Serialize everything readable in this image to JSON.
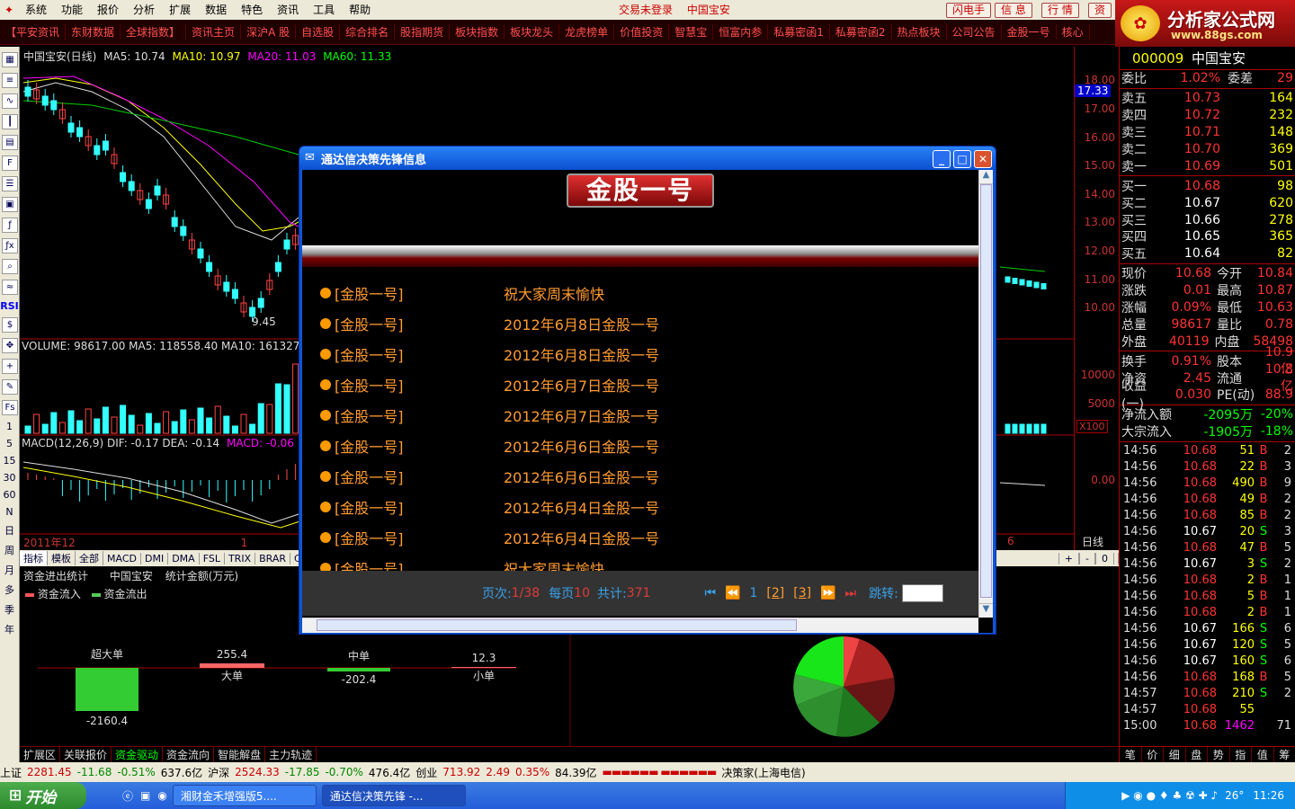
{
  "app": {
    "menu": [
      "系统",
      "功能",
      "报价",
      "分析",
      "扩展",
      "数据",
      "特色",
      "资讯",
      "工具",
      "帮助"
    ],
    "trade_status": "交易未登录",
    "current_stock": "中国宝安",
    "right_buttons": [
      "闪电手",
      "信 息",
      "行 情",
      "资"
    ]
  },
  "brand": {
    "title": "分析家公式网",
    "url": "www.88gs.com"
  },
  "quick_links": [
    "【平安资讯",
    "东财数据",
    "全球指数】",
    "资讯主页",
    "深沪A 股",
    "自选股",
    "综合排名",
    "股指期货",
    "板块指数",
    "板块龙头",
    "龙虎榜单",
    "价值投资",
    "智慧宝",
    "恒富内参",
    "私募密函1",
    "私募密函2",
    "热点板块",
    "公司公告",
    "金股一号",
    "核心"
  ],
  "left_tools": [
    "RSI",
    "1",
    "5",
    "15",
    "30",
    "60",
    "N",
    "日",
    "周",
    "月",
    "多",
    "季",
    "年"
  ],
  "chart": {
    "header_name": "中国宝安(日线)",
    "ma5": "MA5: 10.74",
    "ma10": "MA10: 10.97",
    "ma20": "MA20: 11.03",
    "ma60": "MA60: 11.33",
    "price_axis": [
      "18.00",
      "17.00",
      "16.00",
      "15.00",
      "14.00",
      "13.00",
      "12.00",
      "11.00",
      "10.00"
    ],
    "current_tag": "17.33",
    "low_label": "9.45",
    "volume_line": "VOLUME: 98617.00  MA5: 118558.40  MA10: 161327.20",
    "vol_axis": [
      "10000",
      "5000"
    ],
    "vol_unit": "X100",
    "macd_line": "MACD(12,26,9)  DIF: -0.17  DEA: -0.14",
    "macd_val": "MACD: -0.06",
    "macd_axis": "0.00",
    "date_left": "2011年",
    "date_m1": "12",
    "date_m2": "1",
    "date_m3": "6",
    "period": "日线",
    "indicator_tabs": [
      "指标",
      "模板",
      "全部",
      "MACD",
      "DMI",
      "DMA",
      "FSL",
      "TRIX",
      "BRAR",
      "CR",
      "VR"
    ],
    "zoom_btns": [
      "+",
      "-",
      "0"
    ]
  },
  "fund": {
    "title": "资金进出统计",
    "stock": "中国宝安",
    "unit": "统计金额(万元)",
    "legend_in": "资金流入",
    "legend_out": "资金流出",
    "cats": [
      {
        "name": "超大单",
        "value": "-2160.4"
      },
      {
        "name": "大单",
        "value": "255.4"
      },
      {
        "name": "中单",
        "value": "-202.4"
      },
      {
        "name": "小单",
        "value": "12.3"
      }
    ],
    "bottom_tabs": [
      "扩展区",
      "关联报价",
      "资金驱动",
      "资金流向",
      "智能解盘",
      "主力轨迹"
    ],
    "active_tab": "资金驱动"
  },
  "quote": {
    "code": "000009",
    "name": "中国宝安",
    "weibi": {
      "l": "委比",
      "v": "1.02%",
      "l2": "委差",
      "v2": "29"
    },
    "asks": [
      [
        "卖五",
        "10.73",
        "164"
      ],
      [
        "卖四",
        "10.72",
        "232"
      ],
      [
        "卖三",
        "10.71",
        "148"
      ],
      [
        "卖二",
        "10.70",
        "369"
      ],
      [
        "卖一",
        "10.69",
        "501"
      ]
    ],
    "bids": [
      [
        "买一",
        "10.68",
        "98"
      ],
      [
        "买二",
        "10.67",
        "620"
      ],
      [
        "买三",
        "10.66",
        "278"
      ],
      [
        "买四",
        "10.65",
        "365"
      ],
      [
        "买五",
        "10.64",
        "82"
      ]
    ],
    "stats": [
      [
        "现价",
        "10.68",
        "今开",
        "10.84"
      ],
      [
        "涨跌",
        "0.01",
        "最高",
        "10.87"
      ],
      [
        "涨幅",
        "0.09%",
        "最低",
        "10.63"
      ],
      [
        "总量",
        "98617",
        "量比",
        "0.78"
      ],
      [
        "外盘",
        "40119",
        "内盘",
        "58498"
      ]
    ],
    "stats2": [
      [
        "换手",
        "0.91%",
        "股本",
        "10.9亿"
      ],
      [
        "净资",
        "2.45",
        "流通",
        "10.8亿"
      ],
      [
        "收益(一)",
        "0.030",
        "PE(动)",
        "88.9"
      ]
    ],
    "flows": [
      [
        "净流入额",
        "-2095万",
        "-20%"
      ],
      [
        "大宗流入",
        "-1905万",
        "-18%"
      ]
    ],
    "ticks": [
      [
        "14:56",
        "10.68",
        "51",
        "B",
        "2"
      ],
      [
        "14:56",
        "10.68",
        "22",
        "B",
        "3"
      ],
      [
        "14:56",
        "10.68",
        "490",
        "B",
        "9"
      ],
      [
        "14:56",
        "10.68",
        "49",
        "B",
        "2"
      ],
      [
        "14:56",
        "10.68",
        "85",
        "B",
        "2"
      ],
      [
        "14:56",
        "10.67",
        "20",
        "S",
        "3"
      ],
      [
        "14:56",
        "10.68",
        "47",
        "B",
        "5"
      ],
      [
        "14:56",
        "10.67",
        "3",
        "S",
        "2"
      ],
      [
        "14:56",
        "10.68",
        "2",
        "B",
        "1"
      ],
      [
        "14:56",
        "10.68",
        "5",
        "B",
        "1"
      ],
      [
        "14:56",
        "10.68",
        "2",
        "B",
        "1"
      ],
      [
        "14:56",
        "10.67",
        "166",
        "S",
        "6"
      ],
      [
        "14:56",
        "10.67",
        "120",
        "S",
        "5"
      ],
      [
        "14:56",
        "10.67",
        "160",
        "S",
        "6"
      ],
      [
        "14:56",
        "10.68",
        "168",
        "B",
        "5"
      ],
      [
        "14:57",
        "10.68",
        "210",
        "S",
        "2"
      ],
      [
        "14:57",
        "10.68",
        "55",
        "",
        ""
      ],
      [
        "15:00",
        "10.68",
        "1462",
        "",
        "71"
      ]
    ],
    "tabs": [
      "笔",
      "价",
      "细",
      "盘",
      "势",
      "指",
      "值",
      "筹"
    ]
  },
  "statusbar": {
    "sh": "上证",
    "sh_v": "2281.45",
    "sh_c": "-11.68",
    "sh_p": "-0.51%",
    "sh_a": "637.6亿",
    "hs": "沪深",
    "hs_v": "2524.33",
    "hs_c": "-17.85",
    "hs_p": "-0.70%",
    "hs_a": "476.4亿",
    "cy": "创业",
    "cy_v": "713.92",
    "cy_c": "2.49",
    "cy_p": "0.35%",
    "cy_a": "84.39亿",
    "broker": "决策家(上海电信)"
  },
  "taskbar": {
    "start": "开始",
    "tasks": [
      "湘财金禾增强版5....",
      "通达信决策先锋 -..."
    ],
    "time": "11:26",
    "temp": "26°"
  },
  "dialog": {
    "title": "通达信决策先锋信息",
    "banner": "金股一号",
    "items": [
      [
        "[金股一号]",
        "祝大家周末愉快"
      ],
      [
        "[金股一号]",
        "2012年6月8日金股一号"
      ],
      [
        "[金股一号]",
        "2012年6月8日金股一号"
      ],
      [
        "[金股一号]",
        "2012年6月7日金股一号"
      ],
      [
        "[金股一号]",
        "2012年6月7日金股一号"
      ],
      [
        "[金股一号]",
        "2012年6月6日金股一号"
      ],
      [
        "[金股一号]",
        "2012年6月6日金股一号"
      ],
      [
        "[金股一号]",
        "2012年6月4日金股一号"
      ],
      [
        "[金股一号]",
        "2012年6月4日金股一号"
      ],
      [
        "[金股一号]",
        "祝大家周末愉快"
      ]
    ],
    "pager": {
      "label_page": "页次:",
      "page": "1/38",
      "label_per": "每页",
      "per": "10",
      "label_total": "共计:",
      "total": "371",
      "pages": [
        "1",
        "[2]",
        "[3]"
      ],
      "goto": "跳转:"
    }
  }
}
